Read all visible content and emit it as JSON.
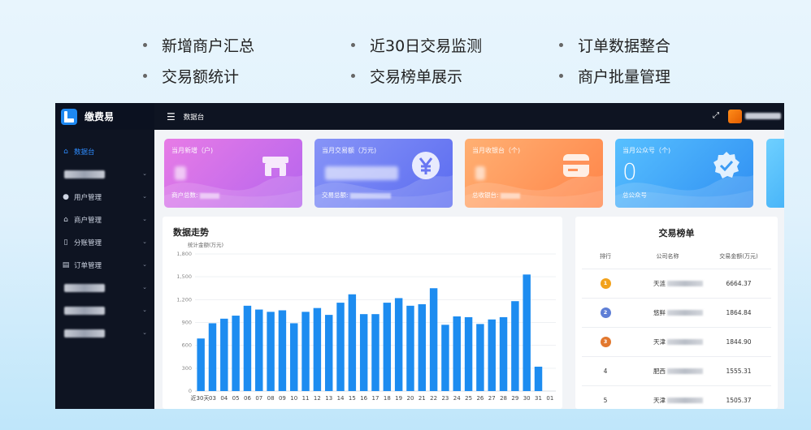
{
  "features": [
    "新增商户汇总",
    "近30日交易监测",
    "订单数据整合",
    "交易额统计",
    "交易榜单展示",
    "商户批量管理"
  ],
  "app": {
    "name": "缴费易",
    "breadcrumb": "数据台",
    "menu": [
      {
        "label": "数据台",
        "icon": "home-icon",
        "active": true
      },
      {
        "label": "",
        "icon": "",
        "redacted": true
      },
      {
        "label": "用户管理",
        "icon": "user-icon"
      },
      {
        "label": "商户管理",
        "icon": "shop-icon"
      },
      {
        "label": "分账管理",
        "icon": "split-icon"
      },
      {
        "label": "订单管理",
        "icon": "order-icon"
      },
      {
        "label": "",
        "icon": "",
        "redacted": true
      },
      {
        "label": "",
        "icon": "",
        "redacted": true
      },
      {
        "label": "",
        "icon": "",
        "redacted": true
      }
    ]
  },
  "cards": [
    {
      "title": "当月新增（户)",
      "value": "",
      "sub": "商户总数:",
      "icon": "store-icon",
      "colors": [
        "#e77be6",
        "#b565ee"
      ]
    },
    {
      "title": "当月交易额（万元)",
      "value": "",
      "sub": "交易总额:",
      "icon": "yen-icon",
      "colors": [
        "#8794f7",
        "#5a6bf0"
      ]
    },
    {
      "title": "当月收银台（个)",
      "value": "",
      "sub": "总收银台:",
      "icon": "card-icon",
      "colors": [
        "#ffb073",
        "#ff8448"
      ]
    },
    {
      "title": "当月公众号（个)",
      "value": "0",
      "sub": "总公众号",
      "icon": "badge-check-icon",
      "colors": [
        "#57c0ff",
        "#2f8ef2"
      ]
    }
  ],
  "trend": {
    "title": "数据走势",
    "unit_label": "统计金额(万元)"
  },
  "chart_data": {
    "type": "bar",
    "title": "数据走势",
    "ylabel": "统计金额(万元)",
    "ylim": [
      0,
      1800
    ],
    "yticks": [
      0,
      300,
      600,
      900,
      1200,
      1500,
      1800
    ],
    "ytick_labels": [
      "0",
      "300",
      "600",
      "900",
      "1,200",
      "1,500",
      "1,800"
    ],
    "categories": [
      "近30天",
      "03",
      "04",
      "05",
      "06",
      "07",
      "08",
      "09",
      "10",
      "11",
      "12",
      "13",
      "14",
      "15",
      "16",
      "17",
      "18",
      "19",
      "20",
      "21",
      "22",
      "23",
      "24",
      "25",
      "26",
      "27",
      "28",
      "29",
      "30",
      "31",
      "01"
    ],
    "values": [
      690,
      890,
      950,
      990,
      1120,
      1070,
      1040,
      1060,
      890,
      1040,
      1090,
      1000,
      1160,
      1270,
      1010,
      1010,
      1160,
      1220,
      1120,
      1140,
      1350,
      870,
      980,
      970,
      880,
      940,
      970,
      1180,
      1530,
      320
    ],
    "color": "#1d8cf0"
  },
  "rank": {
    "title": "交易榜单",
    "headers": [
      "排行",
      "公司名称",
      "交易金额(万元)"
    ],
    "rows": [
      {
        "rank": "1",
        "name": "天涟",
        "amount": "6664.37",
        "medal": "gold-medal-icon"
      },
      {
        "rank": "2",
        "name": "悠鲜",
        "amount": "1864.84",
        "medal": "silver-medal-icon"
      },
      {
        "rank": "3",
        "name": "天津",
        "amount": "1844.90",
        "medal": "bronze-medal-icon"
      },
      {
        "rank": "4",
        "name": "肥西",
        "amount": "1555.31",
        "medal": ""
      },
      {
        "rank": "5",
        "name": "天津",
        "amount": "1505.37",
        "medal": ""
      }
    ]
  }
}
